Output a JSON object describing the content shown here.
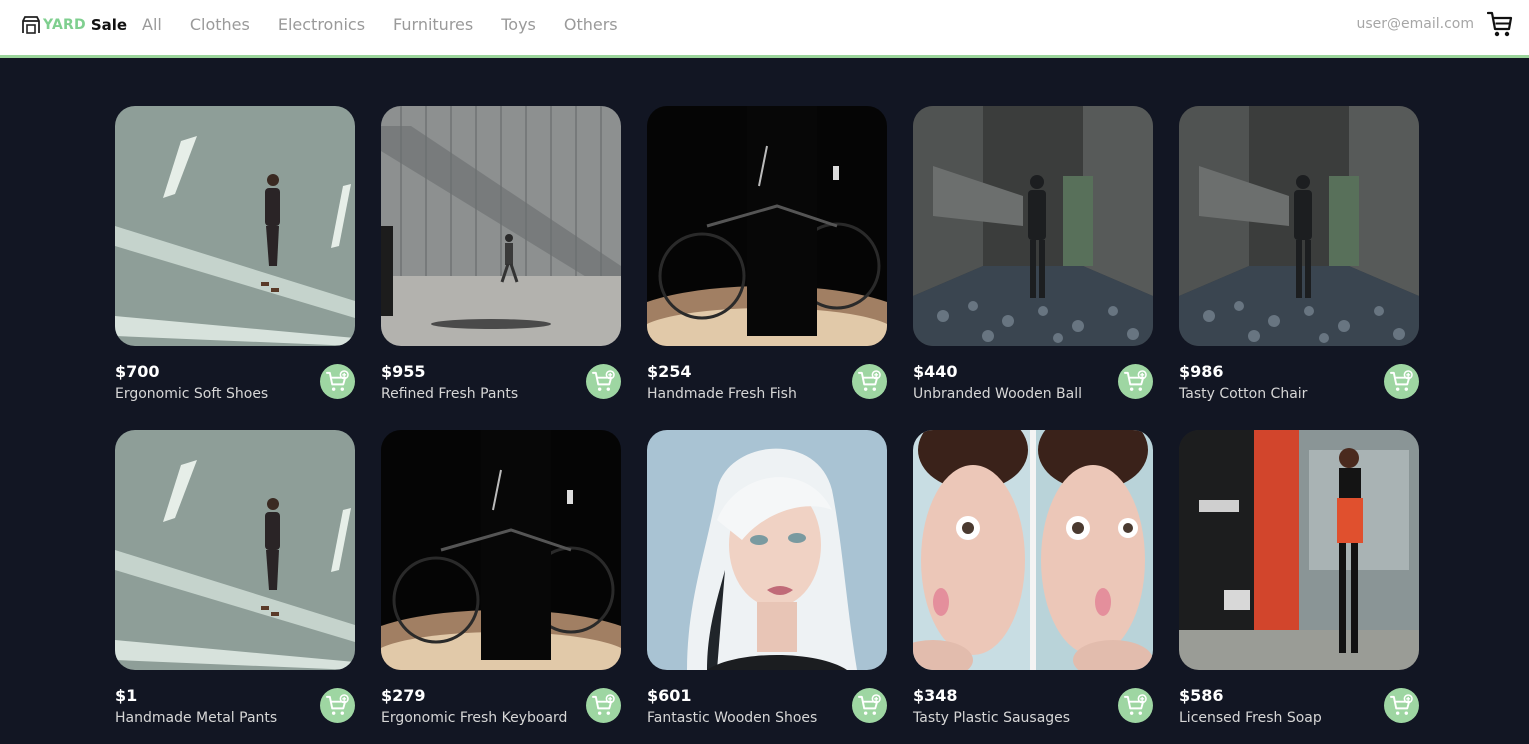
{
  "brand": {
    "yard": "YARD",
    "sale": "Sale"
  },
  "nav": {
    "links": [
      "All",
      "Clothes",
      "Electronics",
      "Furnitures",
      "Toys",
      "Others"
    ]
  },
  "user": {
    "email": "user@email.com"
  },
  "icons": {
    "logo": "storefront-icon",
    "cart": "shopping-cart-icon",
    "add": "add-to-cart-icon"
  },
  "colors": {
    "accent": "#9ed6a2",
    "background": "#121623",
    "navbar": "#ffffff"
  },
  "products": [
    {
      "price": "$700",
      "name": "Ergonomic Soft Shoes",
      "image": "man-walking-on-road"
    },
    {
      "price": "$955",
      "name": "Refined Fresh Pants",
      "image": "man-walking-by-metal-wall"
    },
    {
      "price": "$254",
      "name": "Handmade Fresh Fish",
      "image": "person-with-bicycle-dark"
    },
    {
      "price": "$440",
      "name": "Unbranded Wooden Ball",
      "image": "person-in-concrete-alley"
    },
    {
      "price": "$986",
      "name": "Tasty Cotton Chair",
      "image": "person-in-concrete-alley"
    },
    {
      "price": "$1",
      "name": "Handmade Metal Pants",
      "image": "man-walking-on-road"
    },
    {
      "price": "$279",
      "name": "Ergonomic Fresh Keyboard",
      "image": "person-with-bicycle-dark"
    },
    {
      "price": "$601",
      "name": "Fantastic Wooden Shoes",
      "image": "woman-white-hair-portrait"
    },
    {
      "price": "$348",
      "name": "Tasty Plastic Sausages",
      "image": "woman-funny-face-split"
    },
    {
      "price": "$586",
      "name": "Licensed Fresh Soap",
      "image": "woman-red-dress-phone"
    }
  ]
}
